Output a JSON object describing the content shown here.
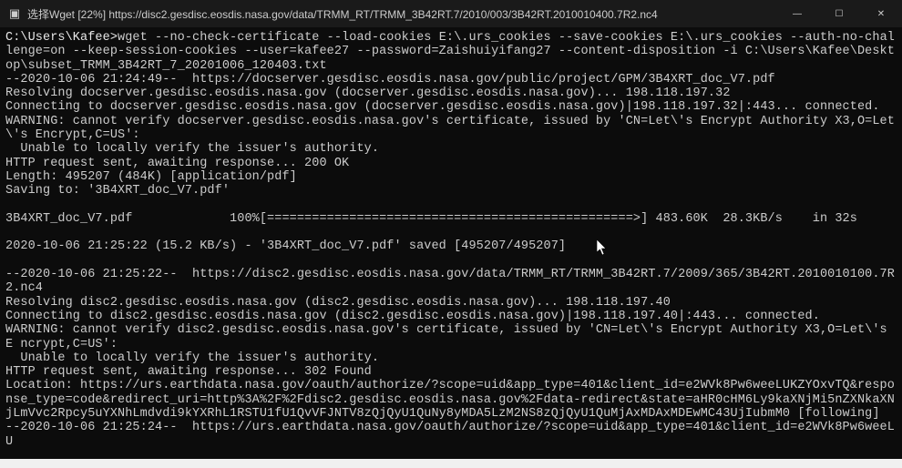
{
  "titlebar": {
    "icon_glyph": "▣",
    "title": "选择Wget [22%] https://disc2.gesdisc.eosdis.nasa.gov/data/TRMM_RT/TRMM_3B42RT.7/2010/003/3B42RT.2010010400.7R2.nc4",
    "minimize": "—",
    "maximize": "☐",
    "close": "✕"
  },
  "terminal": {
    "prompt": "C:\\Users\\Kafee>",
    "command": "wget --no-check-certificate --load-cookies E:\\.urs_cookies --save-cookies E:\\.urs_cookies --auth-no-challenge=on --keep-session-cookies --user=kafee27 --password=Zaishuiyifang27 --content-disposition -i C:\\Users\\Kafee\\Desktop\\subset_TRMM_3B42RT_7_20201006_120403.txt",
    "line01": "--2020-10-06 21:24:49--  https://docserver.gesdisc.eosdis.nasa.gov/public/project/GPM/3B4XRT_doc_V7.pdf",
    "line02": "Resolving docserver.gesdisc.eosdis.nasa.gov (docserver.gesdisc.eosdis.nasa.gov)... 198.118.197.32",
    "line03": "Connecting to docserver.gesdisc.eosdis.nasa.gov (docserver.gesdisc.eosdis.nasa.gov)|198.118.197.32|:443... connected.",
    "line04": "WARNING: cannot verify docserver.gesdisc.eosdis.nasa.gov's certificate, issued by 'CN=Let\\'s Encrypt Authority X3,O=Let\\'s Encrypt,C=US':",
    "line05": "  Unable to locally verify the issuer's authority.",
    "line06": "HTTP request sent, awaiting response... 200 OK",
    "line07": "Length: 495207 (484K) [application/pdf]",
    "line08": "Saving to: '3B4XRT_doc_V7.pdf'",
    "blank1": "",
    "line09": "3B4XRT_doc_V7.pdf             100%[=================================================>] 483.60K  28.3KB/s    in 32s",
    "blank2": "",
    "line10": "2020-10-06 21:25:22 (15.2 KB/s) - '3B4XRT_doc_V7.pdf' saved [495207/495207]",
    "blank3": "",
    "line11": "--2020-10-06 21:25:22--  https://disc2.gesdisc.eosdis.nasa.gov/data/TRMM_RT/TRMM_3B42RT.7/2009/365/3B42RT.2010010100.7R2.nc4",
    "line12": "Resolving disc2.gesdisc.eosdis.nasa.gov (disc2.gesdisc.eosdis.nasa.gov)... 198.118.197.40",
    "line13": "Connecting to disc2.gesdisc.eosdis.nasa.gov (disc2.gesdisc.eosdis.nasa.gov)|198.118.197.40|:443... connected.",
    "line14": "WARNING: cannot verify disc2.gesdisc.eosdis.nasa.gov's certificate, issued by 'CN=Let\\'s Encrypt Authority X3,O=Let\\'s E ncrypt,C=US':",
    "line15": "  Unable to locally verify the issuer's authority.",
    "line16": "HTTP request sent, awaiting response... 302 Found",
    "line17": "Location: https://urs.earthdata.nasa.gov/oauth/authorize/?scope=uid&app_type=401&client_id=e2WVk8Pw6weeLUKZYOxvTQ&response_type=code&redirect_uri=http%3A%2F%2Fdisc2.gesdisc.eosdis.nasa.gov%2Fdata-redirect&state=aHR0cHM6Ly9kaXNjMi5nZXNkaXNjLmVvc2Rpcy5uYXNhLmdvdi9kYXRhL1RSTU1fU1QvVFJNTV8zQjQyU1QuNy8yMDA5LzM2NS8zQjQyU1QuMjAxMDAxMDEwMC43UjIubmM0 [following]",
    "line18": "--2020-10-06 21:25:24--  https://urs.earthdata.nasa.gov/oauth/authorize/?scope=uid&app_type=401&client_id=e2WVk8Pw6weeLU"
  }
}
